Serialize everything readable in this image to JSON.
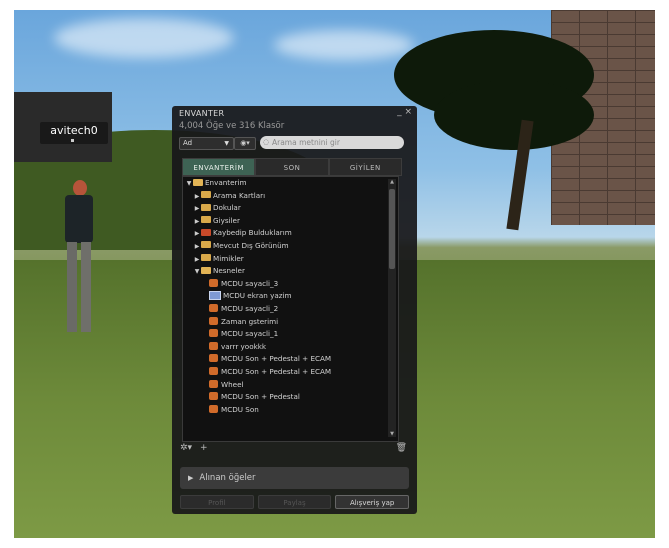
{
  "avatar_name": "avitech0",
  "window": {
    "title": "ENVANTER",
    "minimize": "_",
    "close": "×",
    "stats": "4,004 Öğe ve 316 Klasör"
  },
  "filters": {
    "sort_value": "Ad",
    "eye_label": "◉▾",
    "search_placeholder": "Arama metnini gir"
  },
  "tabs": [
    "ENVANTERİM",
    "SON",
    "GİYİLEN"
  ],
  "tree": {
    "root": "Envanterim",
    "folders": [
      "Arama Kartları",
      "Dokular",
      "Giysiler",
      "Kaybedip Bulduklarım",
      "Mevcut Dış Görünüm",
      "Mimikler"
    ],
    "open_folder": "Nesneler",
    "items": [
      {
        "name": "MCDU sayacli_3",
        "icon": "object-icon"
      },
      {
        "name": "MCDU ekran yazim",
        "icon": "notecard-icon"
      },
      {
        "name": "MCDU sayacli_2",
        "icon": "object-icon"
      },
      {
        "name": "Zaman gsterimi",
        "icon": "object-icon"
      },
      {
        "name": "MCDU sayacli_1",
        "icon": "object-icon"
      },
      {
        "name": "varrr yookkk",
        "icon": "object-icon"
      },
      {
        "name": "MCDU Son + Pedestal + ECAM",
        "icon": "object-icon"
      },
      {
        "name": "MCDU Son + Pedestal + ECAM",
        "icon": "object-icon"
      },
      {
        "name": "Wheel",
        "icon": "object-icon"
      },
      {
        "name": "MCDU Son + Pedestal",
        "icon": "object-icon"
      },
      {
        "name": "MCDU Son",
        "icon": "object-icon"
      }
    ]
  },
  "toolbar": {
    "gear": "✲▾",
    "add": "+",
    "trash": "🗑"
  },
  "received_label": "Alınan öğeler",
  "buttons": {
    "profile": "Profil",
    "share": "Paylaş",
    "shop": "Alışveriş yap"
  }
}
